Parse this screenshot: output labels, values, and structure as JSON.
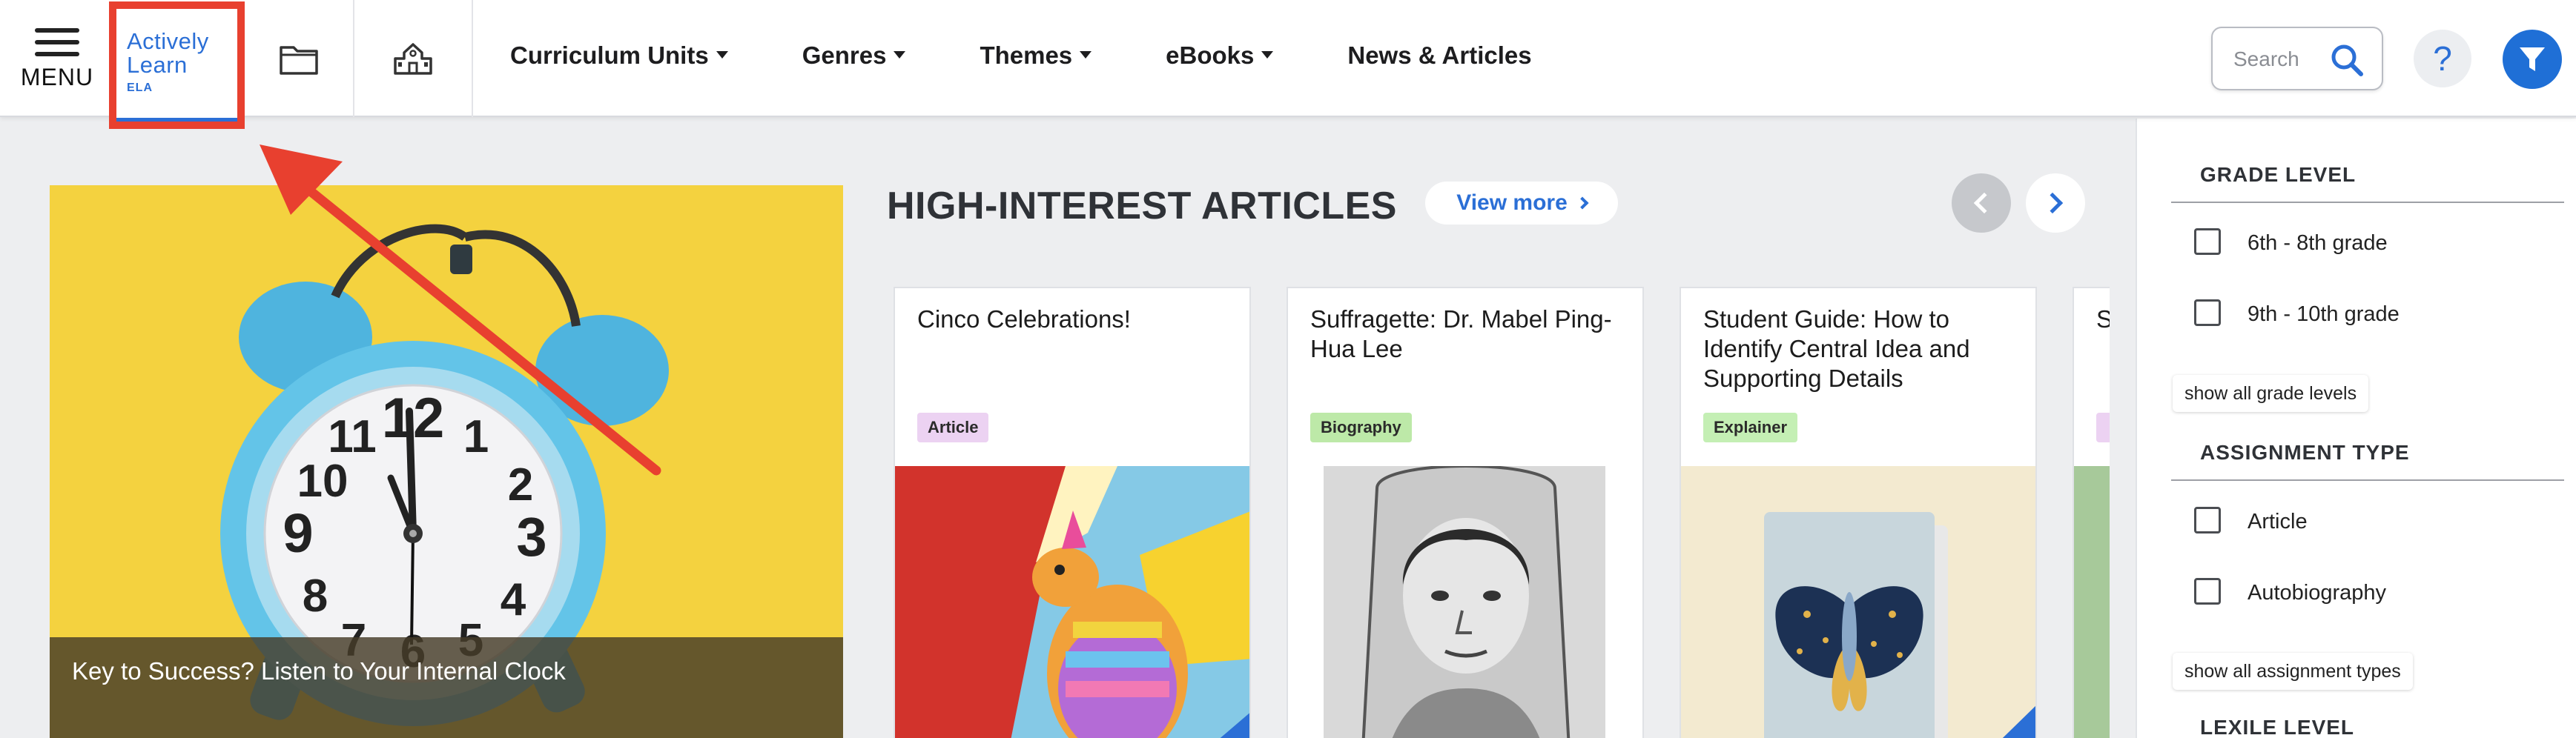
{
  "nav": {
    "menu_label": "MENU",
    "logo": {
      "line1": "Actively",
      "line2": "Learn",
      "tag": "ELA"
    },
    "links": [
      {
        "label": "Curriculum Units",
        "dropdown": true
      },
      {
        "label": "Genres",
        "dropdown": true
      },
      {
        "label": "Themes",
        "dropdown": true
      },
      {
        "label": "eBooks",
        "dropdown": true
      },
      {
        "label": "News & Articles",
        "dropdown": false
      }
    ],
    "search_placeholder": "Search",
    "help_glyph": "?",
    "icons": [
      "folder-icon",
      "school-icon",
      "search-icon",
      "filter-icon"
    ]
  },
  "hero": {
    "caption": "Key to Success? Listen to Your Internal Clock",
    "clock_numbers": [
      "12",
      "11",
      "1",
      "10",
      "2",
      "9",
      "3",
      "8",
      "4",
      "7",
      "6",
      "5"
    ]
  },
  "section": {
    "title": "HIGH-INTEREST ARTICLES",
    "view_more": "View more"
  },
  "cards": [
    {
      "title": "Cinco Celebrations!",
      "badge": "Article",
      "badge_color": "#ecd2f2"
    },
    {
      "title": "Suffragette: Dr. Mabel Ping-Hua Lee",
      "badge": "Biography",
      "badge_color": "#bde9a8"
    },
    {
      "title": "Student Guide: How to Identify Central Idea and Supporting Details",
      "badge": "Explainer",
      "badge_color": "#c4efb4"
    },
    {
      "title": "S a",
      "badge": "",
      "badge_color": "#ecd2f2"
    }
  ],
  "filters": {
    "grade_level": {
      "heading": "GRADE LEVEL",
      "options": [
        "6th - 8th grade",
        "9th - 10th grade"
      ],
      "show_all": "show all grade levels"
    },
    "assignment_type": {
      "heading": "ASSIGNMENT TYPE",
      "options": [
        "Article",
        "Autobiography"
      ],
      "show_all": "show all assignment types"
    },
    "lexile": {
      "heading": "LEXILE LEVEL"
    }
  },
  "colors": {
    "brand_blue": "#2b6fd6",
    "annotation_red": "#e8402f",
    "hero_bg": "#f4d23f"
  }
}
